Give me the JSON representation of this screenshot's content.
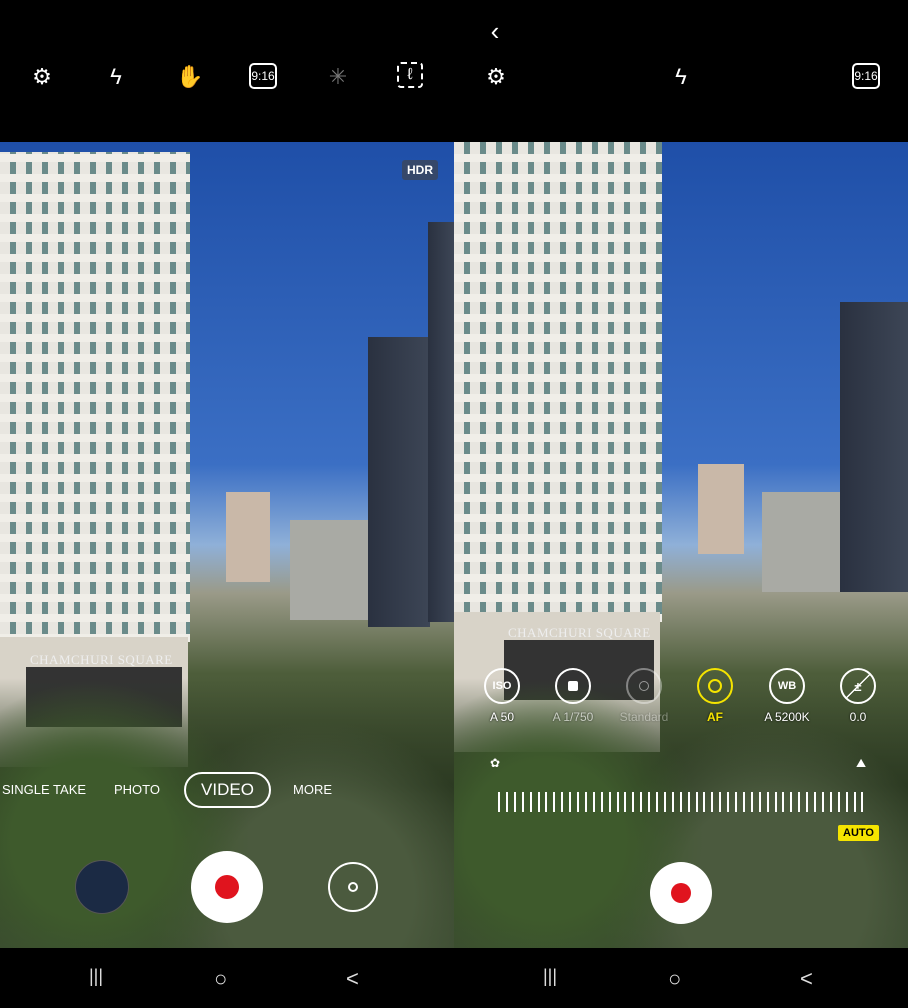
{
  "left": {
    "top_icons": [
      "gear-icon",
      "flash-off-icon",
      "motion-hand-icon",
      "aspect-ratio-icon",
      "effects-icon",
      "scan-icon"
    ],
    "aspect_label": "9:16",
    "hdr_badge": "HDR",
    "sign": "CHAMCHURI SQUARE",
    "modes": [
      "SINGLE TAKE",
      "PHOTO",
      "VIDEO",
      "MORE"
    ],
    "selected_mode": "VIDEO"
  },
  "right": {
    "back_icon": "chevron-left-icon",
    "top_icons": [
      "gear-icon",
      "flash-off-icon",
      "aspect-ratio-icon"
    ],
    "aspect_label": "9:16",
    "sign": "CHAMCHURI SQUARE",
    "pro_controls": [
      {
        "icon": "ISO",
        "label": "A 50"
      },
      {
        "icon": "shutter",
        "label": "A 1/750"
      },
      {
        "icon": "color",
        "label": "Standard"
      },
      {
        "icon": "af",
        "label": "AF",
        "active": true
      },
      {
        "icon": "WB",
        "label": "A 5200K"
      },
      {
        "icon": "exposure",
        "label": "0.0"
      }
    ],
    "auto_badge": "AUTO",
    "accent_color": "#f5e400"
  },
  "nav_bar": {
    "recents": "|||",
    "home": "○",
    "back": "<"
  }
}
